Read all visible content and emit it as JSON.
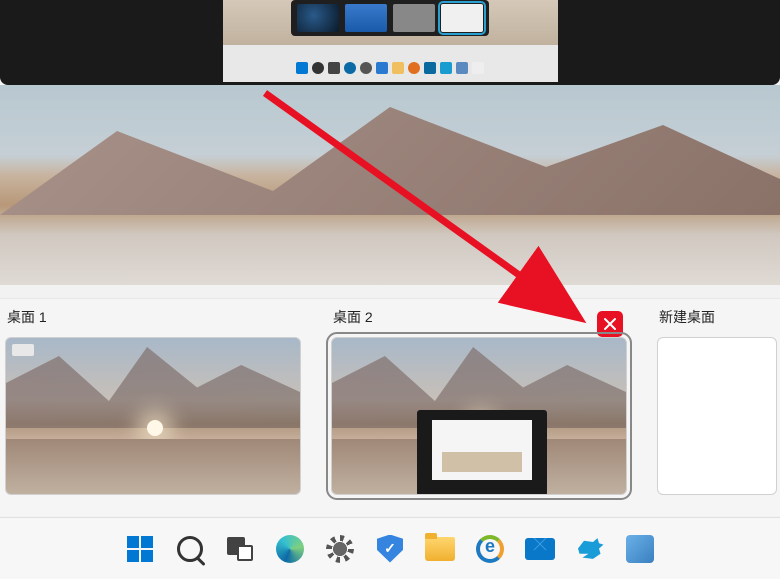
{
  "desktops": {
    "items": [
      {
        "label": "桌面 1"
      },
      {
        "label": "桌面 2"
      }
    ],
    "new_label": "新建桌面",
    "selected_index": 1
  },
  "annotation": {
    "arrow_color": "#e81123",
    "target": "close-button-desktop-2"
  },
  "taskbar": {
    "icons": [
      {
        "name": "start",
        "label": "开始"
      },
      {
        "name": "search",
        "label": "搜索"
      },
      {
        "name": "task-view",
        "label": "任务视图"
      },
      {
        "name": "edge",
        "label": "Microsoft Edge"
      },
      {
        "name": "settings",
        "label": "设置"
      },
      {
        "name": "security",
        "label": "安全中心"
      },
      {
        "name": "file-explorer",
        "label": "文件资源管理器"
      },
      {
        "name": "edge-legacy",
        "label": "Edge 旧版"
      },
      {
        "name": "mail",
        "label": "邮件"
      },
      {
        "name": "messenger",
        "label": "消息"
      },
      {
        "name": "app",
        "label": "应用"
      }
    ]
  },
  "colors": {
    "accent": "#0067c0",
    "close": "#e81123"
  }
}
